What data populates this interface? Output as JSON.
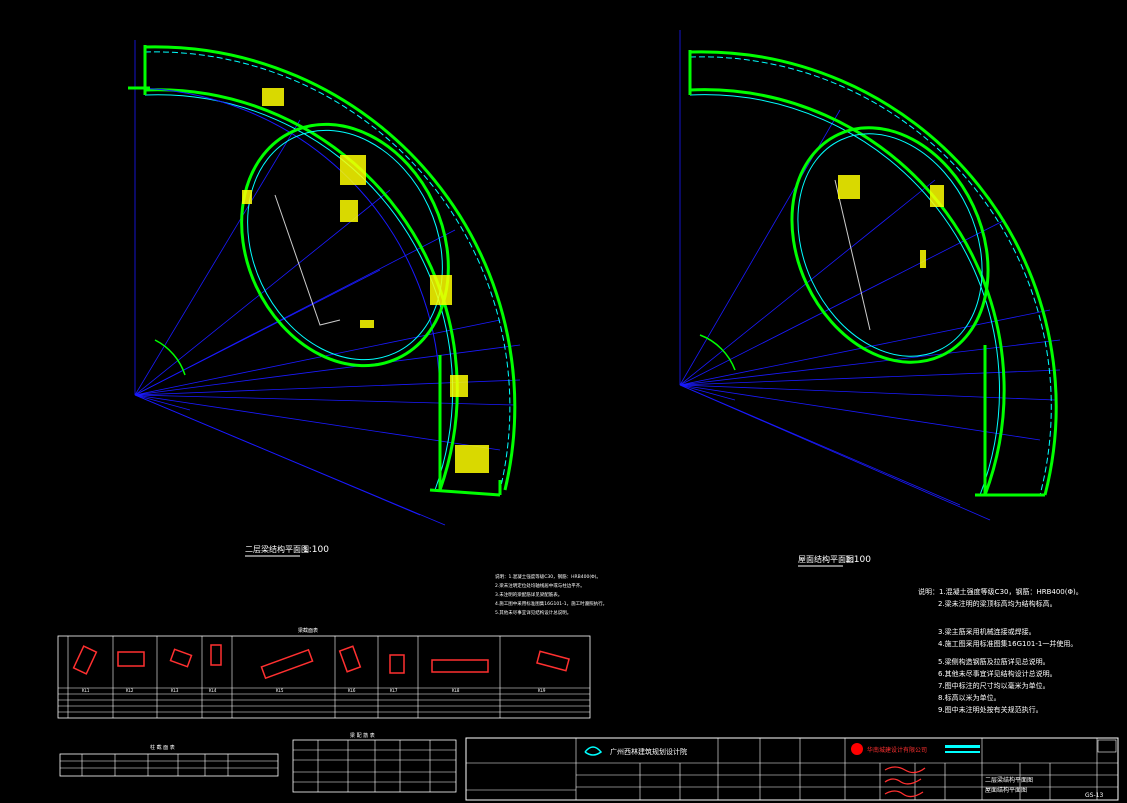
{
  "drawing": {
    "left_plan_title": "二层梁结构平面图",
    "left_plan_scale": "1:100",
    "right_plan_title": "屋面结构平面图",
    "right_plan_scale": "1:100"
  },
  "notes": {
    "lines": [
      "说明：1.混凝土强度等级C30，钢筋：HRB400(Φ)。",
      "2.梁未注明定位处均轴线居中或与柱边平齐。",
      "3.未注明的梁配筋详见梁配筋表。",
      "4.施工图中采用标准图集16G101-1，施工时遵照执行。",
      "5.其他未尽事宜详见结构设计总说明。"
    ],
    "right_lines": [
      "说明：1.混凝土强度等级C30，钢筋：HRB400(Φ)。",
      "2.梁未注明的梁顶标高均为结构标高。",
      "3.梁主筋采用机械连接或焊接。",
      "4.施工图采用标准图集16G101-1一并使用。",
      "5.梁侧构造钢筋及拉筋详见总说明。",
      "6.其他未尽事宜详见结构设计总说明。",
      "7.图中标注的尺寸均以毫米为单位。",
      "8.标高以米为单位。",
      "9.图中未注明处按有关规范执行。"
    ]
  },
  "section_table": {
    "title": "梁截面表",
    "ids": [
      "KL1",
      "KL2",
      "KL3",
      "KL4",
      "KL5",
      "KL6",
      "KL7",
      "KL8",
      "KL9"
    ]
  },
  "tables": {
    "left_title": "柱 截 面 表",
    "right_title": "梁 配 筋 表"
  },
  "title_block": {
    "company": "广州西林建筑规划设计院",
    "partner": "华南城建设计有限公司",
    "drawing_name_1": "二层梁结构平面图",
    "drawing_name_2": "屋面结构平面图",
    "drawing_no": "GS-13"
  },
  "colors": {
    "background": "#000000",
    "green": "#00ff00",
    "cyan": "#00ffff",
    "blue": "#0000ff",
    "yellow": "#ffff00",
    "white": "#ffffff",
    "red": "#ff0000"
  }
}
